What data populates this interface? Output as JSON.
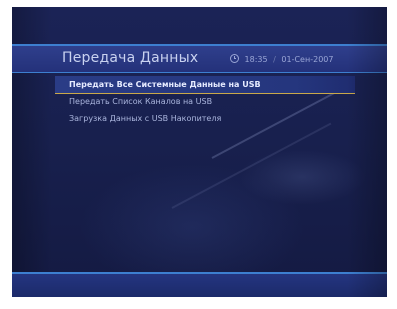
{
  "header": {
    "title": "Передача Данных",
    "time": "18:35",
    "separator": "/",
    "date": "01-Сен-2007"
  },
  "menu": {
    "items": [
      {
        "label": "Передать Все Системные Данные на USB",
        "selected": true
      },
      {
        "label": "Передать Список Каналов на USB",
        "selected": false
      },
      {
        "label": "Загрузка Данных с USB Накопителя",
        "selected": false
      }
    ]
  },
  "colors": {
    "background": "#18204e",
    "title_bar": "#2a3a86",
    "accent_line": "#3d7fd0",
    "selection_underline": "#c9a84a"
  },
  "icons": {
    "clock": "clock-icon"
  }
}
